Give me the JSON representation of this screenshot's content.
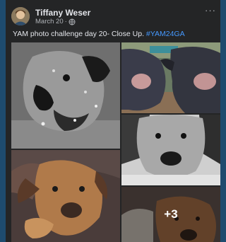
{
  "post": {
    "author": "Tiffany Weser",
    "date": "March 20",
    "date_separator": "·",
    "privacy_icon": "globe-icon",
    "more_options": "···",
    "caption_text": "YAM photo challenge day 20- Close Up. ",
    "caption_hashtag": "#YAM24GA",
    "more_photos_label": "+3"
  },
  "photos": [
    {
      "description_icon": "photo-dog-bw-closeup"
    },
    {
      "description_icon": "photo-cattle-faces"
    },
    {
      "description_icon": "photo-dog-bw-resting"
    },
    {
      "description_icon": "photo-brown-dog-couch"
    },
    {
      "description_icon": "photo-dog-sleeping"
    }
  ],
  "colors": {
    "page_background": "#1e4b6e",
    "card_background": "#242526",
    "primary_text": "#e4e6eb",
    "secondary_text": "#b0b3b8",
    "hashtag": "#4599ff"
  }
}
